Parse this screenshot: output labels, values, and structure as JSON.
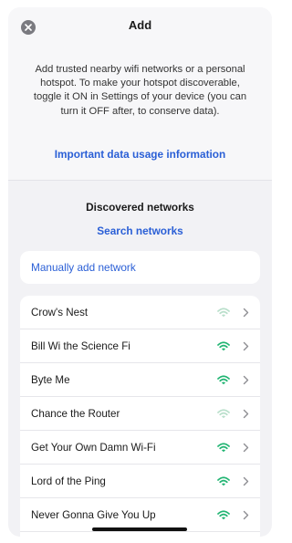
{
  "header": {
    "title": "Add",
    "close_icon": "close-icon"
  },
  "intro": {
    "description": "Add trusted nearby wifi networks or a personal hotspot. To make your hotspot discoverable, toggle it ON in Settings of your device (you can turn it OFF after, to conserve data).",
    "data_usage_link": "Important data usage information"
  },
  "discovered": {
    "title": "Discovered networks",
    "search_link": "Search networks"
  },
  "manual": {
    "label": "Manually add network"
  },
  "networks": [
    {
      "name": "Crow's Nest",
      "signal": "weak"
    },
    {
      "name": "Bill Wi the Science Fi",
      "signal": "strong"
    },
    {
      "name": "Byte Me",
      "signal": "strong"
    },
    {
      "name": "Chance the Router",
      "signal": "weak"
    },
    {
      "name": "Get Your Own Damn Wi-Fi",
      "signal": "strong"
    },
    {
      "name": "Lord of the Ping",
      "signal": "strong"
    },
    {
      "name": "Never Gonna Give You Up",
      "signal": "strong"
    }
  ],
  "colors": {
    "accent": "#2a5fd6",
    "wifi_strong": "#22b573",
    "wifi_weak": "#b9dfcb",
    "chevron": "#8e8e93"
  }
}
